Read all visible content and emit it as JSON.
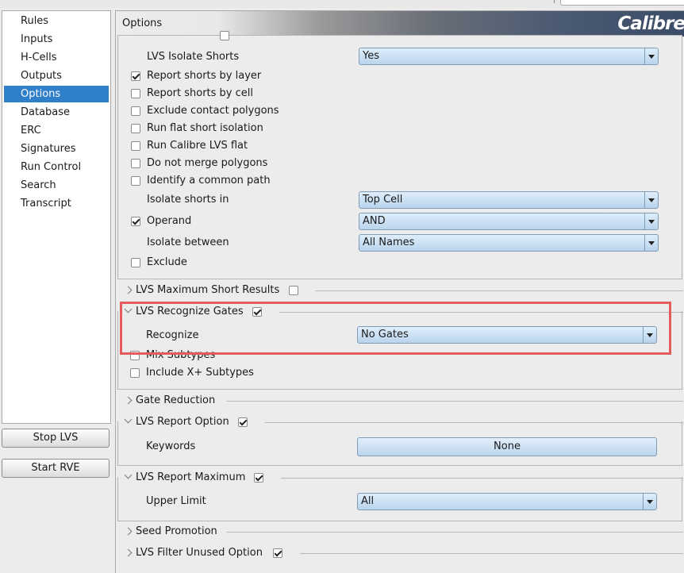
{
  "nav": {
    "items": [
      "Rules",
      "Inputs",
      "H-Cells",
      "Outputs",
      "Options",
      "Database",
      "ERC",
      "Signatures",
      "Run Control",
      "Search",
      "Transcript"
    ],
    "active": "Options"
  },
  "buttons": {
    "stop": "Stop LVS",
    "start": "Start RVE"
  },
  "header": {
    "title": "Options",
    "brand": "Calibre"
  },
  "shorts": {
    "isolate_shorts_label": "LVS Isolate Shorts",
    "isolate_shorts_value": "Yes",
    "report_by_layer": "Report shorts by layer",
    "report_by_cell": "Report shorts by cell",
    "exclude_contact": "Exclude contact polygons",
    "flat_short": "Run flat short isolation",
    "calibre_flat": "Run Calibre LVS flat",
    "no_merge": "Do not merge polygons",
    "common_path": "Identify a common path",
    "isolate_in_label": "Isolate shorts in",
    "isolate_in_value": "Top Cell",
    "operand_label": "Operand",
    "operand_value": "AND",
    "isolate_between_label": "Isolate between",
    "isolate_between_value": "All Names",
    "exclude": "Exclude"
  },
  "sections": {
    "max_short": "LVS Maximum Short Results",
    "recognize_gates": "LVS Recognize Gates",
    "gate_reduction": "Gate Reduction",
    "report_option": "LVS Report Option",
    "report_maximum": "LVS Report Maximum",
    "seed_promotion": "Seed Promotion",
    "filter_unused": "LVS Filter Unused Option"
  },
  "gates": {
    "recognize_label": "Recognize",
    "recognize_value": "No Gates",
    "mix_subtypes": "Mix Subtypes",
    "include_x": "Include X+ Subtypes"
  },
  "report_option": {
    "keywords_label": "Keywords",
    "keywords_value": "None"
  },
  "report_maximum": {
    "upper_limit_label": "Upper Limit",
    "upper_limit_value": "All"
  },
  "colors": {
    "accent": "#2f7fc9",
    "highlight": "#e35b5b"
  }
}
